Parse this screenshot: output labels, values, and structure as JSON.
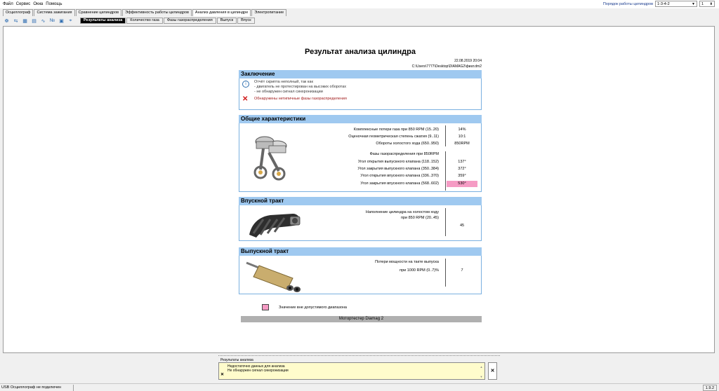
{
  "menu": [
    "Файл",
    "Сервис",
    "Окна",
    "Помощь"
  ],
  "order": {
    "label": "Порядок работы цилиндров",
    "value": "1-3-4-2",
    "cylinder": "1"
  },
  "top_tabs": [
    "Осциллограф",
    "Система зажигания",
    "Сравнение цилиндров",
    "Эффективность работы цилиндров",
    "Анализ давления в цилиндре",
    "Электропитание"
  ],
  "active_top_tab": 4,
  "toolbar_icons": [
    "cylinder-wave-icon",
    "transfer-icon",
    "chart-bars-icon",
    "chart-compare-icon",
    "line-chart-icon",
    "numbers-icon",
    "save-icon",
    "ruler-icon"
  ],
  "sub_tabs": [
    "Результаты анализа",
    "Количество газа",
    "Фазы газораспределения",
    "Выпуск",
    "Впуск"
  ],
  "report": {
    "title": "Результат анализа цилиндра",
    "date": "22.08.2019 20:04",
    "path": "C:\\Users\\7777\\Desktop\\DIAMAG2\\фиат.dm2",
    "conclusion": {
      "heading": "Заключение",
      "info_lines": [
        "Отчёт скрипта неполный, так как",
        "- двигатель не протестирован на высоких оборотах",
        "- не обнаружен сигнал синхронизации"
      ],
      "warning": "Обнаружены нетипичные фазы газораспределения"
    },
    "general": {
      "heading": "Общие характеристики",
      "rows": [
        {
          "label": "Комплексные потери газа при 850 RPM (15..20)",
          "value": "14%",
          "bad": false
        },
        {
          "label": "Оценочная геометрическая степень сжатия (9..11)",
          "value": "10:1",
          "bad": false
        },
        {
          "label": "Обороты холостого хода (650..950)",
          "value": "850RPM",
          "bad": false
        },
        {
          "label": "Фазы газораспределения при 850RPM",
          "value": "",
          "bad": false
        },
        {
          "label": "Угол открытия выпускного клапана (118..152)",
          "value": "137°",
          "bad": false
        },
        {
          "label": "Угол закрытия выпускного клапана (350..384)",
          "value": "372°",
          "bad": false
        },
        {
          "label": "Угол открытия впускного клапана (336..370)",
          "value": "359°",
          "bad": false
        },
        {
          "label": "Угол закрытия впускного клапана (568..602)",
          "value": "530°",
          "bad": true
        }
      ]
    },
    "intake": {
      "heading": "Впускной тракт",
      "label1": "Наполнение цилиндра на холостом ходу",
      "label2": "при 850 RPM (20..45)",
      "value": "45"
    },
    "exhaust": {
      "heading": "Выпускной тракт",
      "label1": "Потери мощности на такте выпуска",
      "label2": "при 1000 RPM (0..7)%",
      "value": "7"
    },
    "legend": "Значение вне допустимого диапазона",
    "footer": "Мотортестер Diamag 2"
  },
  "log": {
    "title": "Результаты анализа",
    "lines": [
      "Недостаточно данных для анализа",
      "Не обнаружен сигнал синхронизации"
    ]
  },
  "status": {
    "text": "USB Осциллограф не подключен",
    "version": "1.9.2"
  },
  "colors": {
    "section_header": "#9fc9f0",
    "out_of_range": "#f59bc4",
    "warning": "#d01818"
  }
}
